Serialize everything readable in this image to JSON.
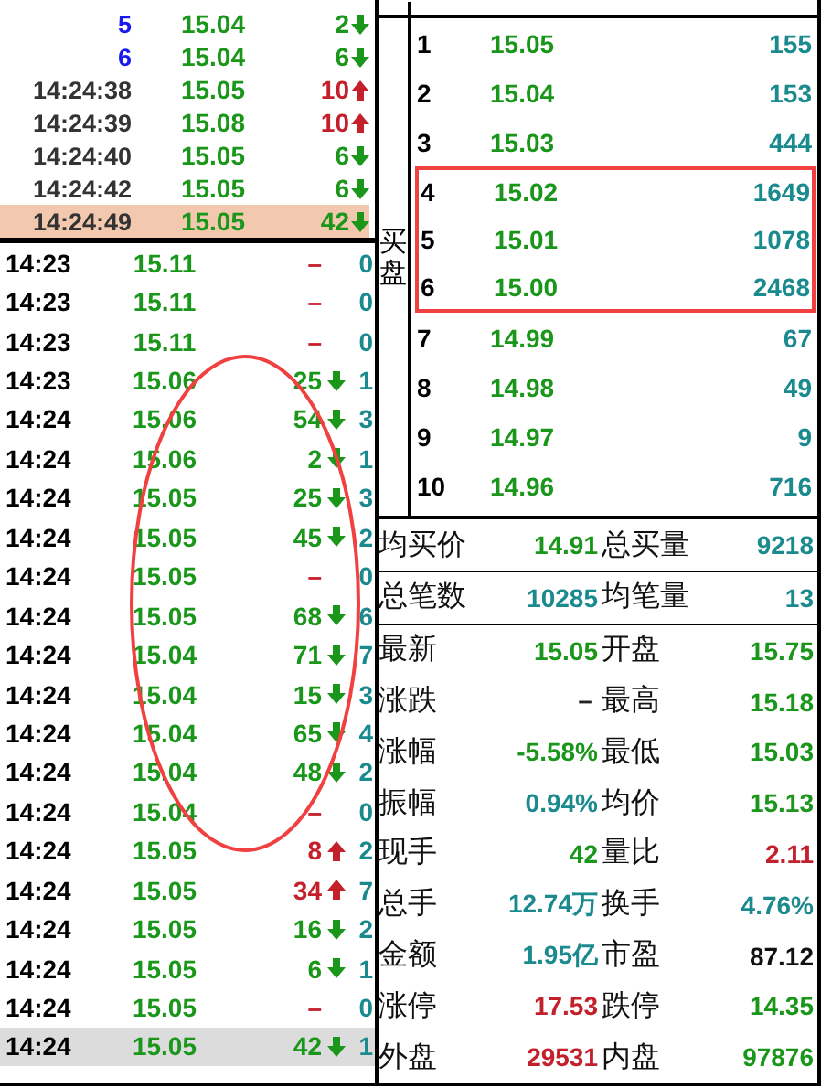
{
  "recent_ticks": [
    {
      "sequence": true,
      "label": "5",
      "price": "15.04",
      "volume": "2",
      "kind": "down",
      "selected": false
    },
    {
      "sequence": true,
      "label": "6",
      "price": "15.04",
      "volume": "6",
      "kind": "down",
      "selected": false
    },
    {
      "sequence": false,
      "label": "14:24:38",
      "price": "15.05",
      "volume": "10",
      "kind": "up",
      "selected": false
    },
    {
      "sequence": false,
      "label": "14:24:39",
      "price": "15.08",
      "volume": "10",
      "kind": "up",
      "selected": false
    },
    {
      "sequence": false,
      "label": "14:24:40",
      "price": "15.05",
      "volume": "6",
      "kind": "down",
      "selected": false
    },
    {
      "sequence": false,
      "label": "14:24:42",
      "price": "15.05",
      "volume": "6",
      "kind": "down",
      "selected": false
    },
    {
      "sequence": false,
      "label": "14:24:49",
      "price": "15.05",
      "volume": "42",
      "kind": "down",
      "selected": true
    }
  ],
  "minute_ticks": [
    {
      "time": "14:23",
      "price": "15.11",
      "volume": "–",
      "kind": "flat",
      "count": "0",
      "selected": false
    },
    {
      "time": "14:23",
      "price": "15.11",
      "volume": "–",
      "kind": "flat",
      "count": "0",
      "selected": false
    },
    {
      "time": "14:23",
      "price": "15.11",
      "volume": "–",
      "kind": "flat",
      "count": "0",
      "selected": false
    },
    {
      "time": "14:23",
      "price": "15.06",
      "volume": "25",
      "kind": "down",
      "count": "1",
      "selected": false
    },
    {
      "time": "14:24",
      "price": "15.06",
      "volume": "54",
      "kind": "down",
      "count": "3",
      "selected": false
    },
    {
      "time": "14:24",
      "price": "15.06",
      "volume": "2",
      "kind": "down",
      "count": "1",
      "selected": false
    },
    {
      "time": "14:24",
      "price": "15.05",
      "volume": "25",
      "kind": "down",
      "count": "3",
      "selected": false
    },
    {
      "time": "14:24",
      "price": "15.05",
      "volume": "45",
      "kind": "down",
      "count": "2",
      "selected": false
    },
    {
      "time": "14:24",
      "price": "15.05",
      "volume": "–",
      "kind": "flat",
      "count": "0",
      "selected": false
    },
    {
      "time": "14:24",
      "price": "15.05",
      "volume": "68",
      "kind": "down",
      "count": "6",
      "selected": false
    },
    {
      "time": "14:24",
      "price": "15.04",
      "volume": "71",
      "kind": "down",
      "count": "7",
      "selected": false
    },
    {
      "time": "14:24",
      "price": "15.04",
      "volume": "15",
      "kind": "down",
      "count": "3",
      "selected": false
    },
    {
      "time": "14:24",
      "price": "15.04",
      "volume": "65",
      "kind": "down",
      "count": "4",
      "selected": false
    },
    {
      "time": "14:24",
      "price": "15.04",
      "volume": "48",
      "kind": "down",
      "count": "2",
      "selected": false
    },
    {
      "time": "14:24",
      "price": "15.04",
      "volume": "–",
      "kind": "flat",
      "count": "0",
      "selected": false
    },
    {
      "time": "14:24",
      "price": "15.05",
      "volume": "8",
      "kind": "up",
      "count": "2",
      "selected": false
    },
    {
      "time": "14:24",
      "price": "15.05",
      "volume": "34",
      "kind": "up",
      "count": "7",
      "selected": false
    },
    {
      "time": "14:24",
      "price": "15.05",
      "volume": "16",
      "kind": "down",
      "count": "2",
      "selected": false
    },
    {
      "time": "14:24",
      "price": "15.05",
      "volume": "6",
      "kind": "down",
      "count": "1",
      "selected": false
    },
    {
      "time": "14:24",
      "price": "15.05",
      "volume": "–",
      "kind": "flat",
      "count": "0",
      "selected": false
    },
    {
      "time": "14:24",
      "price": "15.05",
      "volume": "42",
      "kind": "down",
      "count": "1",
      "selected": true
    }
  ],
  "order_book": {
    "side_label": "买盘",
    "rows": [
      {
        "rank": "1",
        "price": "15.05",
        "volume": "155",
        "highlighted": false
      },
      {
        "rank": "2",
        "price": "15.04",
        "volume": "153",
        "highlighted": false
      },
      {
        "rank": "3",
        "price": "15.03",
        "volume": "444",
        "highlighted": false
      },
      {
        "rank": "4",
        "price": "15.02",
        "volume": "1649",
        "highlighted": true
      },
      {
        "rank": "5",
        "price": "15.01",
        "volume": "1078",
        "highlighted": true
      },
      {
        "rank": "6",
        "price": "15.00",
        "volume": "2468",
        "highlighted": true
      },
      {
        "rank": "7",
        "price": "14.99",
        "volume": "67",
        "highlighted": false
      },
      {
        "rank": "8",
        "price": "14.98",
        "volume": "49",
        "highlighted": false
      },
      {
        "rank": "9",
        "price": "14.97",
        "volume": "9",
        "highlighted": false
      },
      {
        "rank": "10",
        "price": "14.96",
        "volume": "716",
        "highlighted": false
      }
    ]
  },
  "stats": [
    {
      "left": {
        "label": "均买价",
        "value": "14.91",
        "color": "#1a961a"
      },
      "right": {
        "label": "总买量",
        "value": "9218",
        "color": "#1a8a8e"
      }
    },
    {
      "left": {
        "label": "总笔数",
        "value": "10285",
        "color": "#1a8a8e"
      },
      "right": {
        "label": "均笔量",
        "value": "13",
        "color": "#1a8a8e"
      }
    },
    {
      "left": {
        "label": "最新",
        "value": "15.05",
        "color": "#1a961a"
      },
      "right": {
        "label": "开盘",
        "value": "15.75",
        "color": "#1a961a"
      }
    },
    {
      "left": {
        "label": "涨跌",
        "value": "－",
        "color": "#222222"
      },
      "right": {
        "label": "最高",
        "value": "15.18",
        "color": "#1a961a"
      }
    },
    {
      "left": {
        "label": "涨幅",
        "value": "-5.58%",
        "color": "#1a961a"
      },
      "right": {
        "label": "最低",
        "value": "15.03",
        "color": "#1a961a"
      }
    },
    {
      "left": {
        "label": "振幅",
        "value": "0.94%",
        "color": "#1a8a8e"
      },
      "right": {
        "label": "均价",
        "value": "15.13",
        "color": "#1a961a"
      }
    },
    {
      "left": {
        "label": "现手",
        "value": "42",
        "color": "#1a961a"
      },
      "right": {
        "label": "量比",
        "value": "2.11",
        "color": "#c4202c"
      }
    },
    {
      "left": {
        "label": "总手",
        "value": "12.74万",
        "color": "#1a8a8e"
      },
      "right": {
        "label": "换手",
        "value": "4.76%",
        "color": "#1a8a8e"
      }
    },
    {
      "left": {
        "label": "金额",
        "value": "1.95亿",
        "color": "#1a8a8e"
      },
      "right": {
        "label": "市盈",
        "value": "87.12",
        "color": "#111111"
      }
    },
    {
      "left": {
        "label": "涨停",
        "value": "17.53",
        "color": "#c4202c"
      },
      "right": {
        "label": "跌停",
        "value": "14.35",
        "color": "#1a961a"
      }
    },
    {
      "left": {
        "label": "外盘",
        "value": "29531",
        "color": "#c4202c"
      },
      "right": {
        "label": "内盘",
        "value": "97876",
        "color": "#1a961a"
      }
    }
  ]
}
